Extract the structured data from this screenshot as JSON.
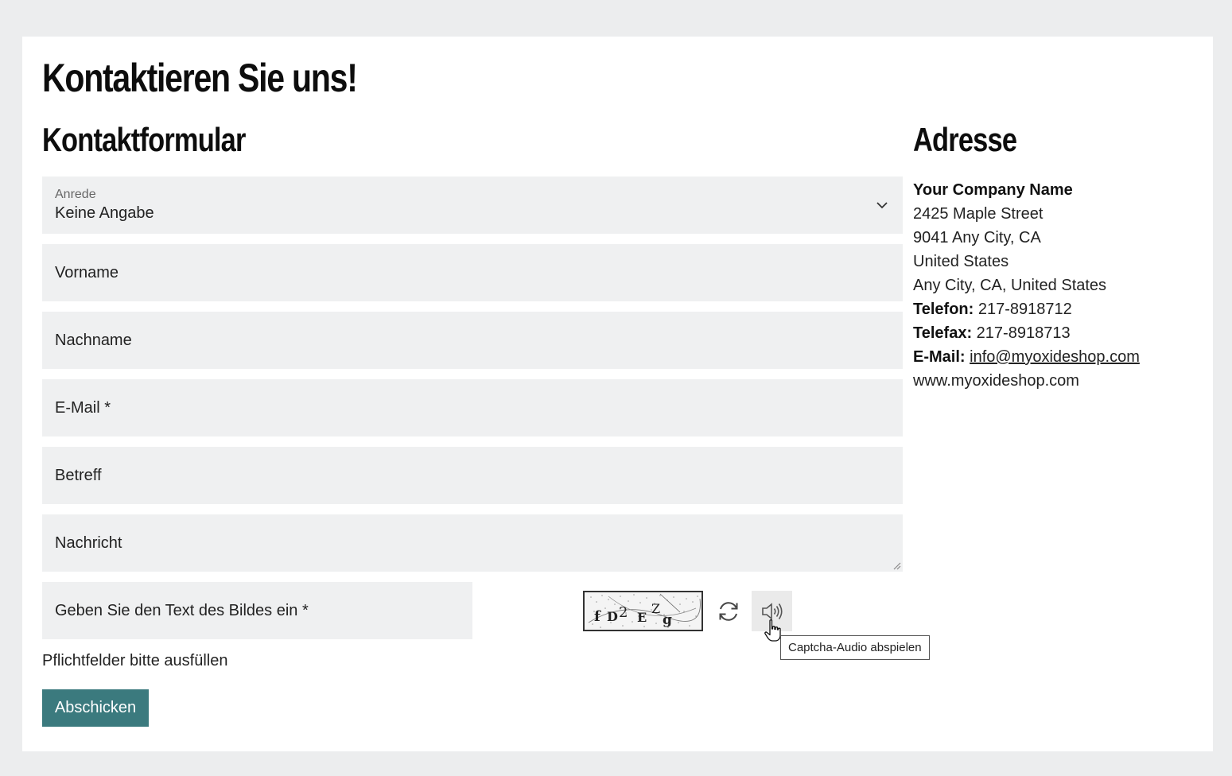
{
  "page": {
    "title": "Kontaktieren Sie uns!"
  },
  "form": {
    "heading": "Kontaktformular",
    "salutation": {
      "label": "Anrede",
      "value": "Keine Angabe"
    },
    "fields": {
      "first_name": "Vorname",
      "last_name": "Nachname",
      "email": "E-Mail *",
      "subject": "Betreff",
      "message": "Nachricht",
      "captcha": "Geben Sie den Text des Bildes ein *"
    },
    "captcha_text": "fD2EZg",
    "audio_tooltip": "Captcha-Audio abspielen",
    "required_note": "Pflichtfelder bitte ausfüllen",
    "submit_label": "Abschicken"
  },
  "address": {
    "heading": "Adresse",
    "company": "Your Company Name",
    "street": "2425 Maple Street",
    "city_line": "9041 Any City, CA",
    "country": "United States",
    "region_line": "Any City, CA, United States",
    "phone_label": "Telefon:",
    "phone": "217-8918712",
    "fax_label": "Telefax:",
    "fax": "217-8918713",
    "email_label": "E-Mail:",
    "email": "info@myoxideshop.com",
    "website": "www.myoxideshop.com"
  },
  "colors": {
    "background": "#ecedee",
    "field_background": "#eff0f1",
    "submit_button": "#3b7a7e"
  }
}
